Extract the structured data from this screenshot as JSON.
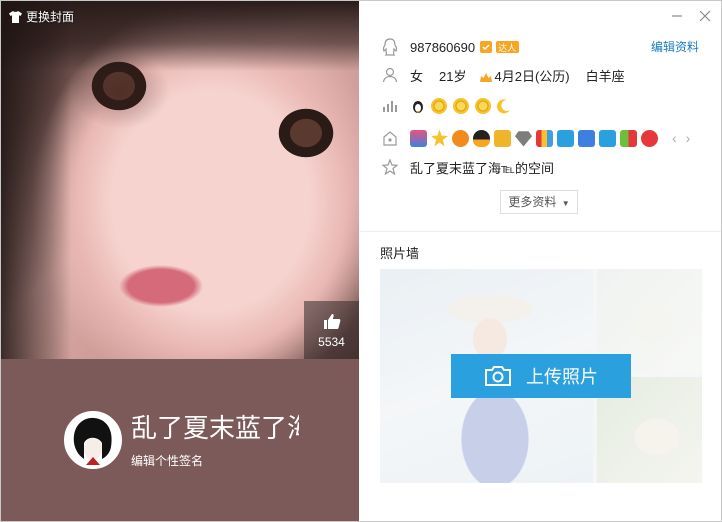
{
  "cover": {
    "change_label": "更换封面",
    "like_count": "5534"
  },
  "profile": {
    "nickname": "乱了夏末蓝了海",
    "signature_edit": "编辑个性签名"
  },
  "info": {
    "qq_number": "987860690",
    "badge_label": "达人",
    "edit_profile": "编辑资料",
    "gender": "女",
    "age": "21岁",
    "birthday": "4月2日(公历)",
    "zodiac": "白羊座",
    "space_name": "乱了夏末蓝了海℡的空间",
    "more_label": "更多资料"
  },
  "photo_wall": {
    "title": "照片墙",
    "upload_label": "上传照片"
  },
  "colors": {
    "profile_band": "#7d5a5a",
    "link_blue": "#1a7bc5",
    "upload_blue": "#2aa0df"
  },
  "service_icons": [
    "qq-show-icon",
    "favorite-icon",
    "game-center-icon",
    "penguin-icon",
    "wallet-icon",
    "diamond-icon",
    "video-icon",
    "music-icon",
    "mail-icon",
    "shop-icon",
    "class-icon",
    "pet-icon"
  ]
}
